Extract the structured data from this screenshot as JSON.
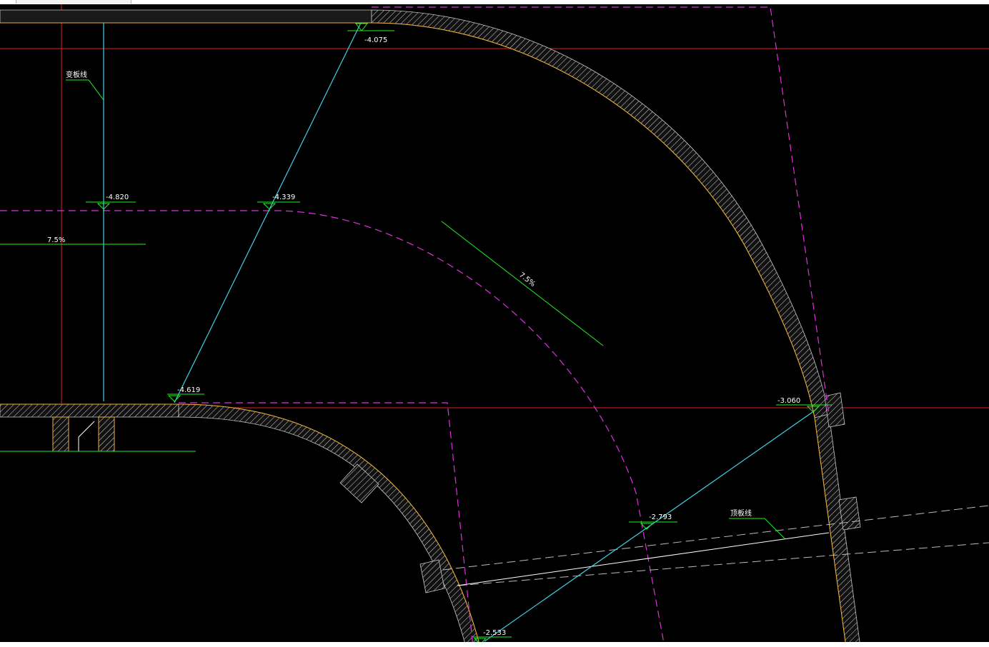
{
  "elevations": {
    "e1": "-4.075",
    "e2": "-4.820",
    "e3": "-4.339",
    "e4": "-4.619",
    "e5": "-3.060",
    "e6": "-2.793",
    "e7": "-2.533"
  },
  "labels": {
    "left_slab_label": "变板线",
    "slope_left": "7.5%",
    "slope_diagonal": "7.5%",
    "top_slab_label": "顶板线"
  },
  "colors": {
    "background": "#000000",
    "red_reference": "#e02020",
    "magenta_dashed": "#e030e0",
    "cyan": "#40d0e8",
    "green": "#22ee22",
    "orange_edge": "#f0b030"
  }
}
